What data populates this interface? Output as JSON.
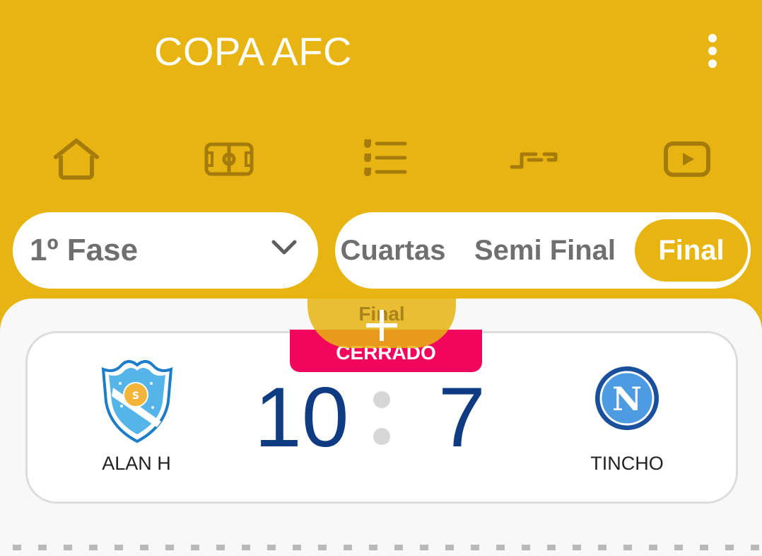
{
  "app": {
    "title": "COPA AFC",
    "menu_icon": "more-vertical-icon"
  },
  "nav": {
    "items": [
      {
        "icon": "home-icon"
      },
      {
        "icon": "soccer-field-icon"
      },
      {
        "icon": "ranking-list-icon"
      },
      {
        "icon": "bracket-icon"
      },
      {
        "icon": "video-play-icon"
      }
    ],
    "icon_color": "#A57C0C"
  },
  "filters": {
    "phase_selected": "1º Fase",
    "stages": [
      "Cuartas",
      "Semi Final",
      "Final"
    ],
    "active_stage": "Final"
  },
  "overlay": {
    "stage_label": "Final"
  },
  "match": {
    "status": "CERRADO",
    "home": {
      "name": "ALAN H",
      "score": "10",
      "crest": "club-crest-icon"
    },
    "away": {
      "name": "TINCHO",
      "score": "7",
      "crest": "napoli-crest-icon"
    }
  },
  "colors": {
    "primary": "#E8B411",
    "status_closed": "#F2055C",
    "score": "#0E3B82"
  }
}
